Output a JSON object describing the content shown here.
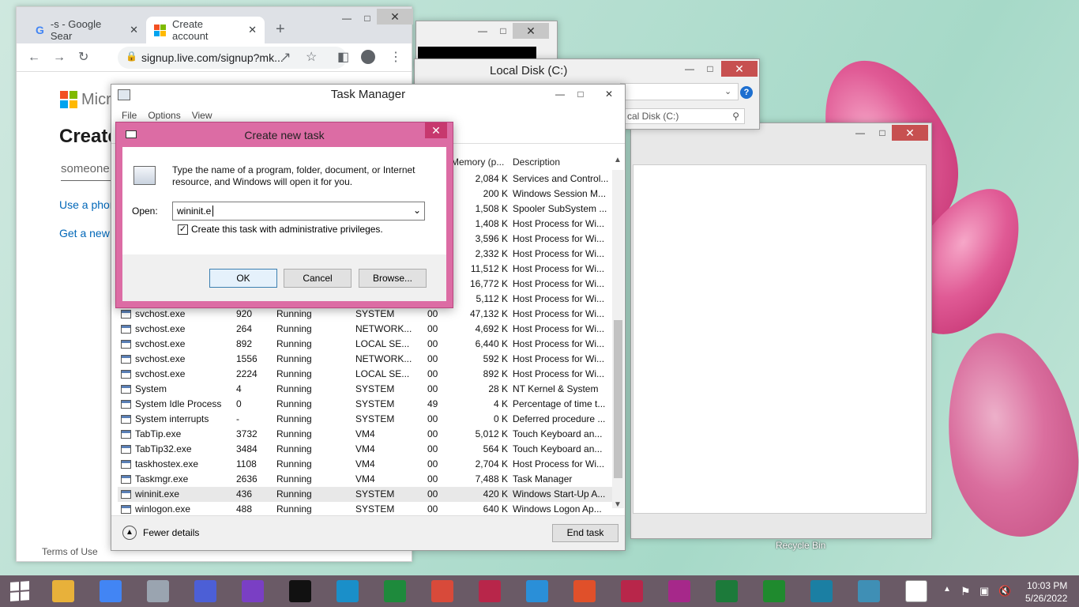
{
  "chrome": {
    "tabs": [
      {
        "label": "-s - Google Sear",
        "icon": "google-g-icon"
      },
      {
        "label": "Create account",
        "icon": "microsoft-logo-icon"
      }
    ],
    "url": "signup.live.com/signup?mk...",
    "page": {
      "brand": "Micr",
      "heading": "Create",
      "email_placeholder": "someone",
      "link_phone": "Use a phor",
      "link_new": "Get a new",
      "footer": "Terms of Use"
    }
  },
  "explorer": {
    "title": "Local Disk (C:)",
    "search_placeholder": "cal Disk (C:)"
  },
  "desktop": {
    "recycle_bin": "Recycle Bin"
  },
  "task_manager": {
    "title": "Task Manager",
    "menu": [
      "File",
      "Options",
      "View"
    ],
    "columns": {
      "memory": "Memory (p...",
      "description": "Description"
    },
    "top_rows": [
      {
        "memory": "2,084 K",
        "description": "Services and Control..."
      },
      {
        "memory": "200 K",
        "description": "Windows Session M..."
      },
      {
        "memory": "1,508 K",
        "description": "Spooler SubSystem ..."
      },
      {
        "memory": "1,408 K",
        "description": "Host Process for Wi..."
      },
      {
        "memory": "3,596 K",
        "description": "Host Process for Wi..."
      },
      {
        "memory": "2,332 K",
        "description": "Host Process for Wi..."
      },
      {
        "memory": "11,512 K",
        "description": "Host Process for Wi..."
      },
      {
        "memory": "16,772 K",
        "description": "Host Process for Wi..."
      },
      {
        "memory": "5,112 K",
        "description": "Host Process for Wi..."
      }
    ],
    "rows": [
      {
        "name": "svchost.exe",
        "pid": "920",
        "status": "Running",
        "user": "SYSTEM",
        "cpu": "00",
        "memory": "47,132 K",
        "description": "Host Process for Wi..."
      },
      {
        "name": "svchost.exe",
        "pid": "264",
        "status": "Running",
        "user": "NETWORK...",
        "cpu": "00",
        "memory": "4,692 K",
        "description": "Host Process for Wi..."
      },
      {
        "name": "svchost.exe",
        "pid": "892",
        "status": "Running",
        "user": "LOCAL SE...",
        "cpu": "00",
        "memory": "6,440 K",
        "description": "Host Process for Wi..."
      },
      {
        "name": "svchost.exe",
        "pid": "1556",
        "status": "Running",
        "user": "NETWORK...",
        "cpu": "00",
        "memory": "592 K",
        "description": "Host Process for Wi..."
      },
      {
        "name": "svchost.exe",
        "pid": "2224",
        "status": "Running",
        "user": "LOCAL SE...",
        "cpu": "00",
        "memory": "892 K",
        "description": "Host Process for Wi..."
      },
      {
        "name": "System",
        "pid": "4",
        "status": "Running",
        "user": "SYSTEM",
        "cpu": "00",
        "memory": "28 K",
        "description": "NT Kernel & System"
      },
      {
        "name": "System Idle Process",
        "pid": "0",
        "status": "Running",
        "user": "SYSTEM",
        "cpu": "49",
        "memory": "4 K",
        "description": "Percentage of time t..."
      },
      {
        "name": "System interrupts",
        "pid": "-",
        "status": "Running",
        "user": "SYSTEM",
        "cpu": "00",
        "memory": "0 K",
        "description": "Deferred procedure ..."
      },
      {
        "name": "TabTip.exe",
        "pid": "3732",
        "status": "Running",
        "user": "VM4",
        "cpu": "00",
        "memory": "5,012 K",
        "description": "Touch Keyboard an..."
      },
      {
        "name": "TabTip32.exe",
        "pid": "3484",
        "status": "Running",
        "user": "VM4",
        "cpu": "00",
        "memory": "564 K",
        "description": "Touch Keyboard an..."
      },
      {
        "name": "taskhostex.exe",
        "pid": "1108",
        "status": "Running",
        "user": "VM4",
        "cpu": "00",
        "memory": "2,704 K",
        "description": "Host Process for Wi..."
      },
      {
        "name": "Taskmgr.exe",
        "pid": "2636",
        "status": "Running",
        "user": "VM4",
        "cpu": "00",
        "memory": "7,488 K",
        "description": "Task Manager"
      },
      {
        "name": "wininit.exe",
        "pid": "436",
        "status": "Running",
        "user": "SYSTEM",
        "cpu": "00",
        "memory": "420 K",
        "description": "Windows Start-Up A..."
      },
      {
        "name": "winlogon.exe",
        "pid": "488",
        "status": "Running",
        "user": "SYSTEM",
        "cpu": "00",
        "memory": "640 K",
        "description": "Windows Logon Ap..."
      }
    ],
    "selected_row": 12,
    "fewer_details": "Fewer details",
    "end_task": "End task"
  },
  "dialog": {
    "title": "Create new task",
    "description": "Type the name of a program, folder, document, or Internet resource, and Windows will open it for you.",
    "open_label": "Open:",
    "open_value": "wininit.e",
    "admin_label": "Create this task with administrative privileges.",
    "admin_checked": true,
    "ok": "OK",
    "cancel": "Cancel",
    "browse": "Browse..."
  },
  "taskbar": {
    "time": "10:03 PM",
    "date": "5/26/2022",
    "apps": [
      {
        "name": "file-explorer-icon",
        "color": "#e8b13a"
      },
      {
        "name": "chrome-icon",
        "color": "#4285f4"
      },
      {
        "name": "task-manager-icon",
        "color": "#9aa4b0"
      },
      {
        "name": "settings-icon",
        "color": "#4c5fd6"
      },
      {
        "name": "trophy-icon",
        "color": "#7a3fc4"
      },
      {
        "name": "cmd-icon",
        "color": "#111111"
      },
      {
        "name": "store-icon",
        "color": "#1a8fc9"
      },
      {
        "name": "excel-icon",
        "color": "#1e8a3c"
      },
      {
        "name": "health-icon",
        "color": "#d84a3a"
      },
      {
        "name": "news-icon",
        "color": "#b8264a"
      },
      {
        "name": "weather-icon",
        "color": "#2a8fd8"
      },
      {
        "name": "music-icon",
        "color": "#e0502a"
      },
      {
        "name": "video-icon",
        "color": "#b8264a"
      },
      {
        "name": "camera-icon",
        "color": "#a6288a"
      },
      {
        "name": "finance-icon",
        "color": "#1c7a3a"
      },
      {
        "name": "games-icon",
        "color": "#1f8a2e"
      },
      {
        "name": "food-icon",
        "color": "#1b7fa3"
      },
      {
        "name": "cube-app-icon",
        "color": "#3f8fb5"
      },
      {
        "name": "blank-document-icon",
        "color": "#ffffff"
      }
    ]
  }
}
